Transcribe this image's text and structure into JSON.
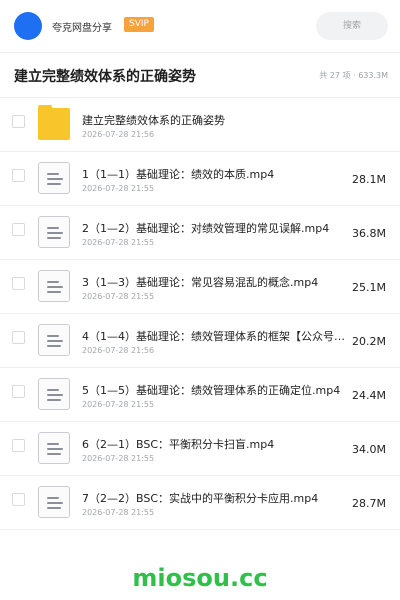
{
  "header": {
    "brand": "夸克网盘分享",
    "badge": "SVIP",
    "search_label": "搜索"
  },
  "folder": {
    "title": "建立完整绩效体系的正确姿势",
    "meta": "共 27 项 · 633.3M"
  },
  "items": [
    {
      "type": "folder",
      "icon": "folder-icon",
      "name": "建立完整绩效体系的正确姿势",
      "date": "2026-07-28 21:56",
      "size": ""
    },
    {
      "type": "file",
      "icon": "file-icon",
      "name": "1（1—1）基础理论：绩效的本质.mp4",
      "date": "2026-07-28 21:55",
      "size": "28.1M"
    },
    {
      "type": "file",
      "icon": "file-icon",
      "name": "2（1—2）基础理论：对绩效管理的常见误解.mp4",
      "date": "2026-07-28 21:55",
      "size": "36.8M"
    },
    {
      "type": "file",
      "icon": "file-icon",
      "name": "3（1—3）基础理论：常见容易混乱的概念.mp4",
      "date": "2026-07-28 21:55",
      "size": "25.1M"
    },
    {
      "type": "file",
      "icon": "file-icon",
      "name": "4（1—4）基础理论：绩效管理体系的框架【公众号：…",
      "date": "2026-07-28 21:56",
      "size": "20.2M"
    },
    {
      "type": "file",
      "icon": "file-icon",
      "name": "5（1—5）基础理论：绩效管理体系的正确定位.mp4",
      "date": "2026-07-28 21:55",
      "size": "24.4M"
    },
    {
      "type": "file",
      "icon": "file-icon",
      "name": "6（2—1）BSC：平衡积分卡扫盲.mp4",
      "date": "2026-07-28 21:55",
      "size": "34.0M"
    },
    {
      "type": "file",
      "icon": "file-icon",
      "name": "7（2—2）BSC：实战中的平衡积分卡应用.mp4",
      "date": "2026-07-28 21:55",
      "size": "28.7M"
    }
  ],
  "watermark": "miosou.cc",
  "colors": {
    "accent": "#1e6ff1",
    "badge": "#f7a23b",
    "folder": "#f8c52a",
    "watermark": "#2fbf4a"
  }
}
